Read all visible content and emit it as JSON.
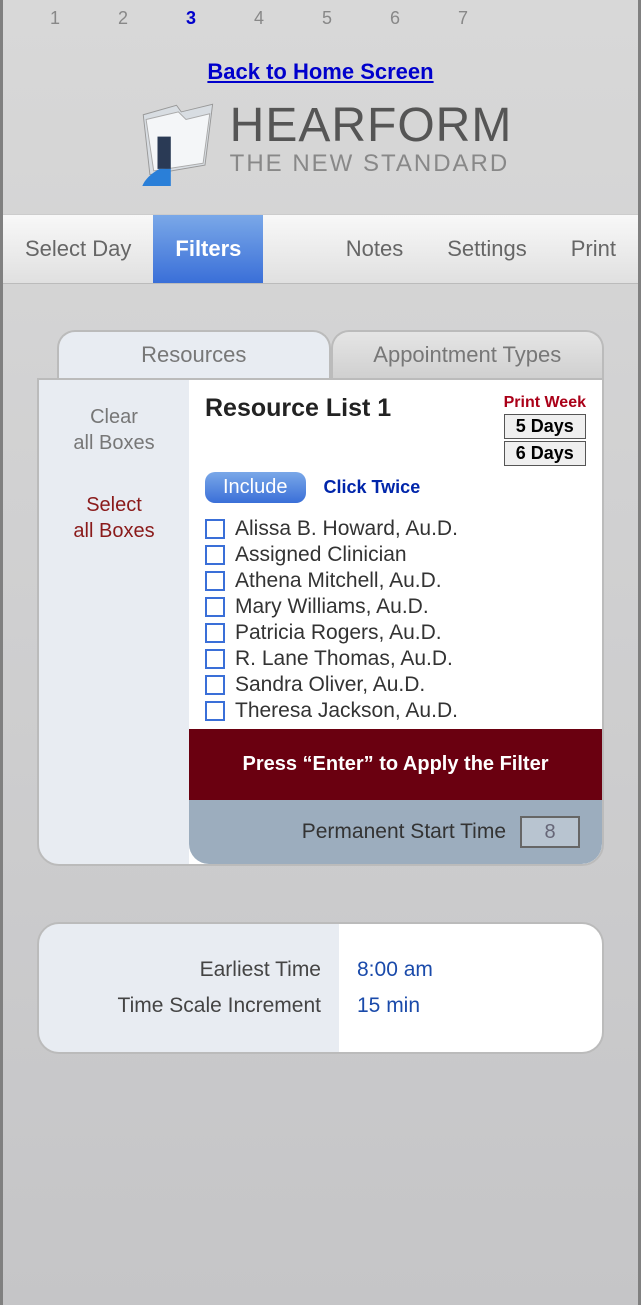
{
  "pages": {
    "items": [
      "1",
      "2",
      "3",
      "4",
      "5",
      "6",
      "7"
    ],
    "active_index": 2
  },
  "home_link": "Back to Home Screen",
  "brand": {
    "name": "HEARFORM",
    "tagline": "THE NEW STANDARD"
  },
  "tabs": {
    "items": [
      "Select Day",
      "Filters",
      "Notes",
      "Settings",
      "Print"
    ],
    "active_index": 1
  },
  "subtabs": {
    "items": [
      "Resources",
      "Appointment Types"
    ],
    "active_index": 0
  },
  "side": {
    "clear": "Clear\nall Boxes",
    "select": "Select\nall Boxes"
  },
  "resource_panel": {
    "title": "Resource List 1",
    "include_btn": "Include",
    "click_twice": "Click Twice",
    "print_week_label": "Print Week",
    "print_week_5": "5 Days",
    "print_week_6": "6 Days",
    "items": [
      "Alissa B. Howard, Au.D.",
      "Assigned Clinician",
      "Athena Mitchell, Au.D.",
      "Mary Williams, Au.D.",
      "Patricia Rogers, Au.D.",
      "R. Lane Thomas, Au.D.",
      "Sandra Oliver, Au.D.",
      "Theresa Jackson, Au.D."
    ],
    "apply_msg": "Press “Enter” to Apply the Filter",
    "perm_label": "Permanent Start Time",
    "perm_value": "8"
  },
  "time_panel": {
    "earliest_label": "Earliest Time",
    "earliest_value": "8:00 am",
    "increment_label": "Time Scale Increment",
    "increment_value": "15 min"
  }
}
